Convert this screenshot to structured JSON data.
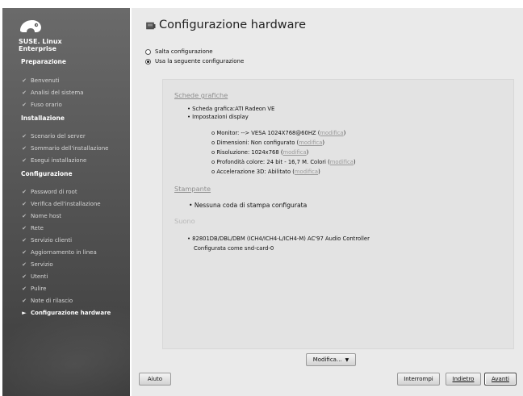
{
  "sidebar": {
    "brand_line1": "SUSE. Linux",
    "brand_line2": "Enterprise",
    "sections": [
      {
        "title": "Preparazione",
        "items": [
          {
            "label": "Benvenuti",
            "state": "done"
          },
          {
            "label": "Analisi del sistema",
            "state": "done"
          },
          {
            "label": "Fuso orario",
            "state": "done"
          }
        ]
      },
      {
        "title": "Installazione",
        "items": [
          {
            "label": "Scenario del server",
            "state": "done"
          },
          {
            "label": "Sommario dell'installazione",
            "state": "done"
          },
          {
            "label": "Esegui installazione",
            "state": "done"
          }
        ]
      },
      {
        "title": "Configurazione",
        "items": [
          {
            "label": "Password di root",
            "state": "done"
          },
          {
            "label": "Verifica dell'installazione",
            "state": "done"
          },
          {
            "label": "Nome host",
            "state": "done"
          },
          {
            "label": "Rete",
            "state": "done"
          },
          {
            "label": "Servizio clienti",
            "state": "done"
          },
          {
            "label": "Aggiornamento in linea",
            "state": "done"
          },
          {
            "label": "Servizio",
            "state": "done"
          },
          {
            "label": "Utenti",
            "state": "done"
          },
          {
            "label": "Pulire",
            "state": "done"
          },
          {
            "label": "Note di rilascio",
            "state": "done"
          },
          {
            "label": "Configurazione hardware",
            "state": "current"
          }
        ]
      }
    ]
  },
  "main": {
    "title": "Configurazione hardware",
    "radio_skip": "Salta configurazione",
    "radio_use": "Usa la seguente configurazione",
    "graphics": {
      "heading": "Schede grafiche",
      "card": "Scheda grafica:ATI Radeon VE",
      "display": "Impostazioni display",
      "monitor": "Monitor: --> VESA 1024X768@60HZ (",
      "dimensioni": "Dimensioni: Non configurato (",
      "risoluzione": "Risoluzione: 1024x768 (",
      "profondita": "Profondità colore: 24 bit - 16,7 M. Colori (",
      "accelerazione": "Accelerazione 3D: Abilitato (",
      "modifica_link": "modifica"
    },
    "printers": {
      "heading": "Stampante",
      "line": "Nessuna coda di stampa configurata"
    },
    "sound": {
      "heading": "Suono",
      "device": "82801DB/DBL/DBM (ICH4/ICH4-L/ICH4-M) AC'97 Audio Controller",
      "config": "Configurata come snd-card-0"
    },
    "buttons": {
      "modifica": "Modifica...",
      "aiuto": "Aiuto",
      "interrompi": "Interrompi",
      "indietro": "Indietro",
      "avanti": "Avanti"
    }
  },
  "colors": {
    "sidebar_bg": "#5a5a5a",
    "main_bg": "#eaeaea",
    "link_gray": "#9a9a9a"
  }
}
